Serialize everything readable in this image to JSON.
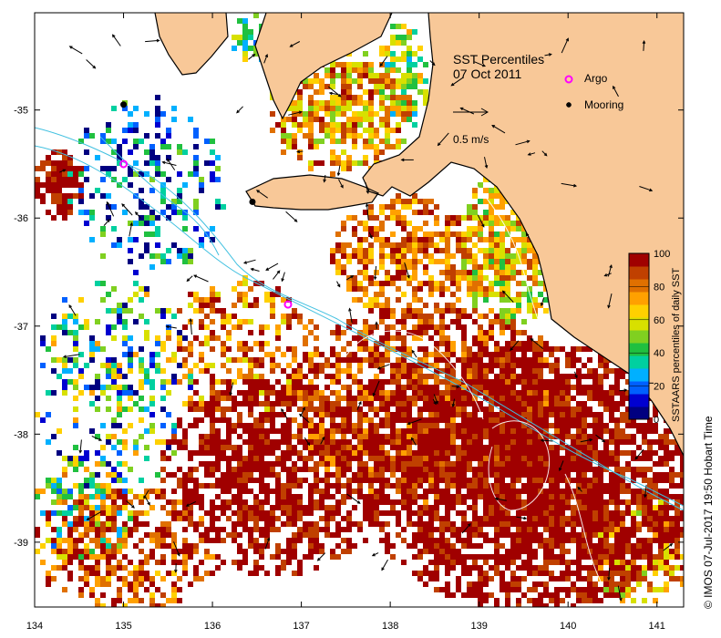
{
  "title": {
    "line1": "SST Percentiles",
    "line2": "07 Oct 2011"
  },
  "legend": {
    "argo_label": "Argo",
    "mooring_label": "Mooring",
    "argo_color": "#ff00ff",
    "mooring_color": "#000000",
    "arrow_scale_label": "0.5 m/s"
  },
  "colorbar": {
    "label": "SSTAARS percentiles of daily  SST",
    "ticks": [
      "0",
      "20",
      "40",
      "60",
      "80",
      "100"
    ],
    "colors": [
      "#000080",
      "#0000d0",
      "#0060ff",
      "#00b0ff",
      "#00d0a0",
      "#20c040",
      "#80d020",
      "#d8e000",
      "#ffd000",
      "#ffa000",
      "#e07000",
      "#c04000",
      "#a00000"
    ]
  },
  "axes": {
    "x_ticks": [
      "134",
      "135",
      "136",
      "137",
      "138",
      "139",
      "140",
      "141"
    ],
    "y_ticks": [
      "-35",
      "-36",
      "-37",
      "-38",
      "-39"
    ],
    "lon_range": [
      134,
      141.3
    ],
    "lat_range": [
      -34.1,
      -39.6
    ]
  },
  "markers": {
    "argo": [
      [
        135.0,
        -35.5
      ],
      [
        136.85,
        -36.8
      ]
    ],
    "moorings": [
      [
        135.0,
        -34.95
      ],
      [
        136.45,
        -35.85
      ]
    ]
  },
  "credit": "© IMOS 07-Jul-2017 19:50 Hobart Time",
  "colors": {
    "land": "#f8c898",
    "coast": "#000000",
    "bathy_contour": "#40c0e0",
    "frame": "#000000"
  }
}
